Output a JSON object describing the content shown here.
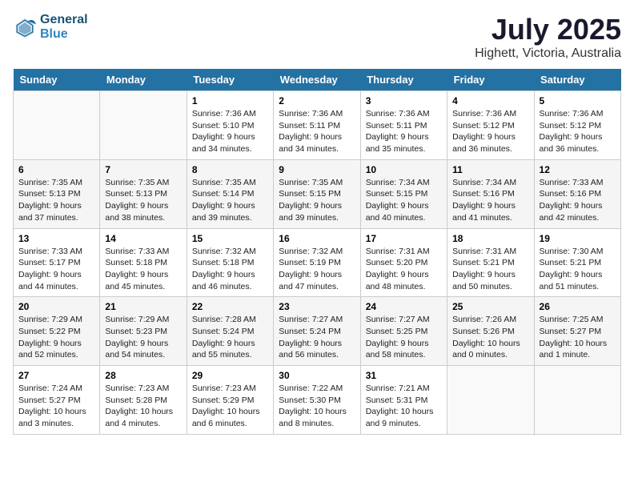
{
  "header": {
    "logo_line1": "General",
    "logo_line2": "Blue",
    "title": "July 2025",
    "subtitle": "Highett, Victoria, Australia"
  },
  "weekdays": [
    "Sunday",
    "Monday",
    "Tuesday",
    "Wednesday",
    "Thursday",
    "Friday",
    "Saturday"
  ],
  "weeks": [
    [
      {
        "num": "",
        "detail": ""
      },
      {
        "num": "",
        "detail": ""
      },
      {
        "num": "1",
        "detail": "Sunrise: 7:36 AM\nSunset: 5:10 PM\nDaylight: 9 hours\nand 34 minutes."
      },
      {
        "num": "2",
        "detail": "Sunrise: 7:36 AM\nSunset: 5:11 PM\nDaylight: 9 hours\nand 34 minutes."
      },
      {
        "num": "3",
        "detail": "Sunrise: 7:36 AM\nSunset: 5:11 PM\nDaylight: 9 hours\nand 35 minutes."
      },
      {
        "num": "4",
        "detail": "Sunrise: 7:36 AM\nSunset: 5:12 PM\nDaylight: 9 hours\nand 36 minutes."
      },
      {
        "num": "5",
        "detail": "Sunrise: 7:36 AM\nSunset: 5:12 PM\nDaylight: 9 hours\nand 36 minutes."
      }
    ],
    [
      {
        "num": "6",
        "detail": "Sunrise: 7:35 AM\nSunset: 5:13 PM\nDaylight: 9 hours\nand 37 minutes."
      },
      {
        "num": "7",
        "detail": "Sunrise: 7:35 AM\nSunset: 5:13 PM\nDaylight: 9 hours\nand 38 minutes."
      },
      {
        "num": "8",
        "detail": "Sunrise: 7:35 AM\nSunset: 5:14 PM\nDaylight: 9 hours\nand 39 minutes."
      },
      {
        "num": "9",
        "detail": "Sunrise: 7:35 AM\nSunset: 5:15 PM\nDaylight: 9 hours\nand 39 minutes."
      },
      {
        "num": "10",
        "detail": "Sunrise: 7:34 AM\nSunset: 5:15 PM\nDaylight: 9 hours\nand 40 minutes."
      },
      {
        "num": "11",
        "detail": "Sunrise: 7:34 AM\nSunset: 5:16 PM\nDaylight: 9 hours\nand 41 minutes."
      },
      {
        "num": "12",
        "detail": "Sunrise: 7:33 AM\nSunset: 5:16 PM\nDaylight: 9 hours\nand 42 minutes."
      }
    ],
    [
      {
        "num": "13",
        "detail": "Sunrise: 7:33 AM\nSunset: 5:17 PM\nDaylight: 9 hours\nand 44 minutes."
      },
      {
        "num": "14",
        "detail": "Sunrise: 7:33 AM\nSunset: 5:18 PM\nDaylight: 9 hours\nand 45 minutes."
      },
      {
        "num": "15",
        "detail": "Sunrise: 7:32 AM\nSunset: 5:18 PM\nDaylight: 9 hours\nand 46 minutes."
      },
      {
        "num": "16",
        "detail": "Sunrise: 7:32 AM\nSunset: 5:19 PM\nDaylight: 9 hours\nand 47 minutes."
      },
      {
        "num": "17",
        "detail": "Sunrise: 7:31 AM\nSunset: 5:20 PM\nDaylight: 9 hours\nand 48 minutes."
      },
      {
        "num": "18",
        "detail": "Sunrise: 7:31 AM\nSunset: 5:21 PM\nDaylight: 9 hours\nand 50 minutes."
      },
      {
        "num": "19",
        "detail": "Sunrise: 7:30 AM\nSunset: 5:21 PM\nDaylight: 9 hours\nand 51 minutes."
      }
    ],
    [
      {
        "num": "20",
        "detail": "Sunrise: 7:29 AM\nSunset: 5:22 PM\nDaylight: 9 hours\nand 52 minutes."
      },
      {
        "num": "21",
        "detail": "Sunrise: 7:29 AM\nSunset: 5:23 PM\nDaylight: 9 hours\nand 54 minutes."
      },
      {
        "num": "22",
        "detail": "Sunrise: 7:28 AM\nSunset: 5:24 PM\nDaylight: 9 hours\nand 55 minutes."
      },
      {
        "num": "23",
        "detail": "Sunrise: 7:27 AM\nSunset: 5:24 PM\nDaylight: 9 hours\nand 56 minutes."
      },
      {
        "num": "24",
        "detail": "Sunrise: 7:27 AM\nSunset: 5:25 PM\nDaylight: 9 hours\nand 58 minutes."
      },
      {
        "num": "25",
        "detail": "Sunrise: 7:26 AM\nSunset: 5:26 PM\nDaylight: 10 hours\nand 0 minutes."
      },
      {
        "num": "26",
        "detail": "Sunrise: 7:25 AM\nSunset: 5:27 PM\nDaylight: 10 hours\nand 1 minute."
      }
    ],
    [
      {
        "num": "27",
        "detail": "Sunrise: 7:24 AM\nSunset: 5:27 PM\nDaylight: 10 hours\nand 3 minutes."
      },
      {
        "num": "28",
        "detail": "Sunrise: 7:23 AM\nSunset: 5:28 PM\nDaylight: 10 hours\nand 4 minutes."
      },
      {
        "num": "29",
        "detail": "Sunrise: 7:23 AM\nSunset: 5:29 PM\nDaylight: 10 hours\nand 6 minutes."
      },
      {
        "num": "30",
        "detail": "Sunrise: 7:22 AM\nSunset: 5:30 PM\nDaylight: 10 hours\nand 8 minutes."
      },
      {
        "num": "31",
        "detail": "Sunrise: 7:21 AM\nSunset: 5:31 PM\nDaylight: 10 hours\nand 9 minutes."
      },
      {
        "num": "",
        "detail": ""
      },
      {
        "num": "",
        "detail": ""
      }
    ]
  ]
}
